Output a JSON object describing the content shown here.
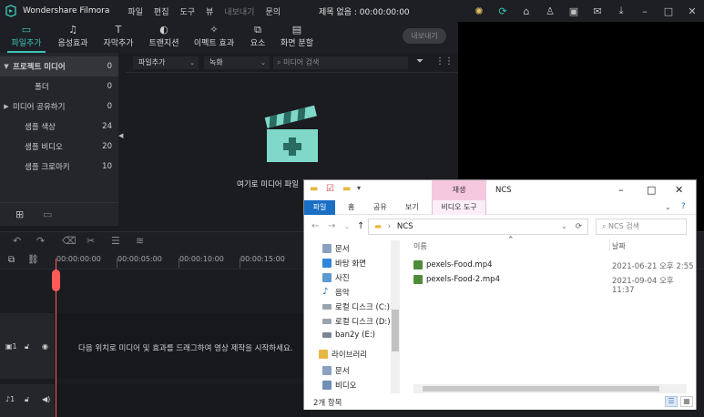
{
  "app": {
    "name": "Wondershare Filmora",
    "menu": [
      "파일",
      "편집",
      "도구",
      "뷰",
      "내보내기",
      "문의"
    ],
    "project_title": "제목 없음 : 00:00:00:00",
    "title_icons": [
      "bulb-icon",
      "sync-icon",
      "gift-icon",
      "user-icon",
      "save-icon",
      "mail-icon",
      "download-icon",
      "minimize-icon",
      "maximize-icon",
      "close-icon"
    ]
  },
  "tabs": [
    {
      "label": "파일추가",
      "icon": "folder-icon",
      "active": true
    },
    {
      "label": "음성효과",
      "icon": "music-icon",
      "active": false
    },
    {
      "label": "자막추가",
      "icon": "text-icon",
      "active": false
    },
    {
      "label": "트랜지션",
      "icon": "transition-icon",
      "active": false
    },
    {
      "label": "이펙트 효과",
      "icon": "effects-icon",
      "active": false
    },
    {
      "label": "요소",
      "icon": "elements-icon",
      "active": false
    },
    {
      "label": "화면 분할",
      "icon": "split-screen-icon",
      "active": false
    }
  ],
  "export_label": "내보내기",
  "sidebar": {
    "items": [
      {
        "label": "프로젝트 미디어",
        "count": "0",
        "expanded": true,
        "selected": true
      },
      {
        "label": "폴더",
        "count": "0",
        "indent": true
      },
      {
        "label": "미디어 공유하기",
        "count": "0",
        "collapsed": true
      },
      {
        "label": "샘플 색상",
        "count": "24"
      },
      {
        "label": "샘플 비디오",
        "count": "20"
      },
      {
        "label": "샘플 크로마키",
        "count": "10"
      }
    ]
  },
  "media": {
    "import_dropdown": "파일추가",
    "record_dropdown": "녹화",
    "search_placeholder": "미디어 검색",
    "drop_text": "여기로 미디어 파일"
  },
  "timeline": {
    "timecodes": [
      "00:00:00:00",
      "00:00:05:00",
      "00:00:10:00",
      "00:00:15:00"
    ],
    "hint": "다음 위치로 미디어 및 효과를 드래그하여 영상 제작을 시작하세요."
  },
  "explorer": {
    "title": "NCS",
    "context_tab": "재생",
    "ribbon_tabs": [
      "파일",
      "홈",
      "공유",
      "보기",
      "비디오 도구"
    ],
    "address": "NCS",
    "search_placeholder": "NCS 검색",
    "nav_items": [
      "문서",
      "바탕 화면",
      "사진",
      "음악",
      "로컬 디스크 (C:)",
      "로컬 디스크 (D:)",
      "ban2y (E:)",
      "라이브러리",
      "문서",
      "비디오"
    ],
    "col_name": "이름",
    "col_date": "날짜",
    "files": [
      {
        "name": "pexels-Food.mp4",
        "date": "2021-06-21 오후 2:55"
      },
      {
        "name": "pexels-Food-2.mp4",
        "date": "2021-09-04 오후 11:37"
      }
    ],
    "status": "2개 항목"
  }
}
